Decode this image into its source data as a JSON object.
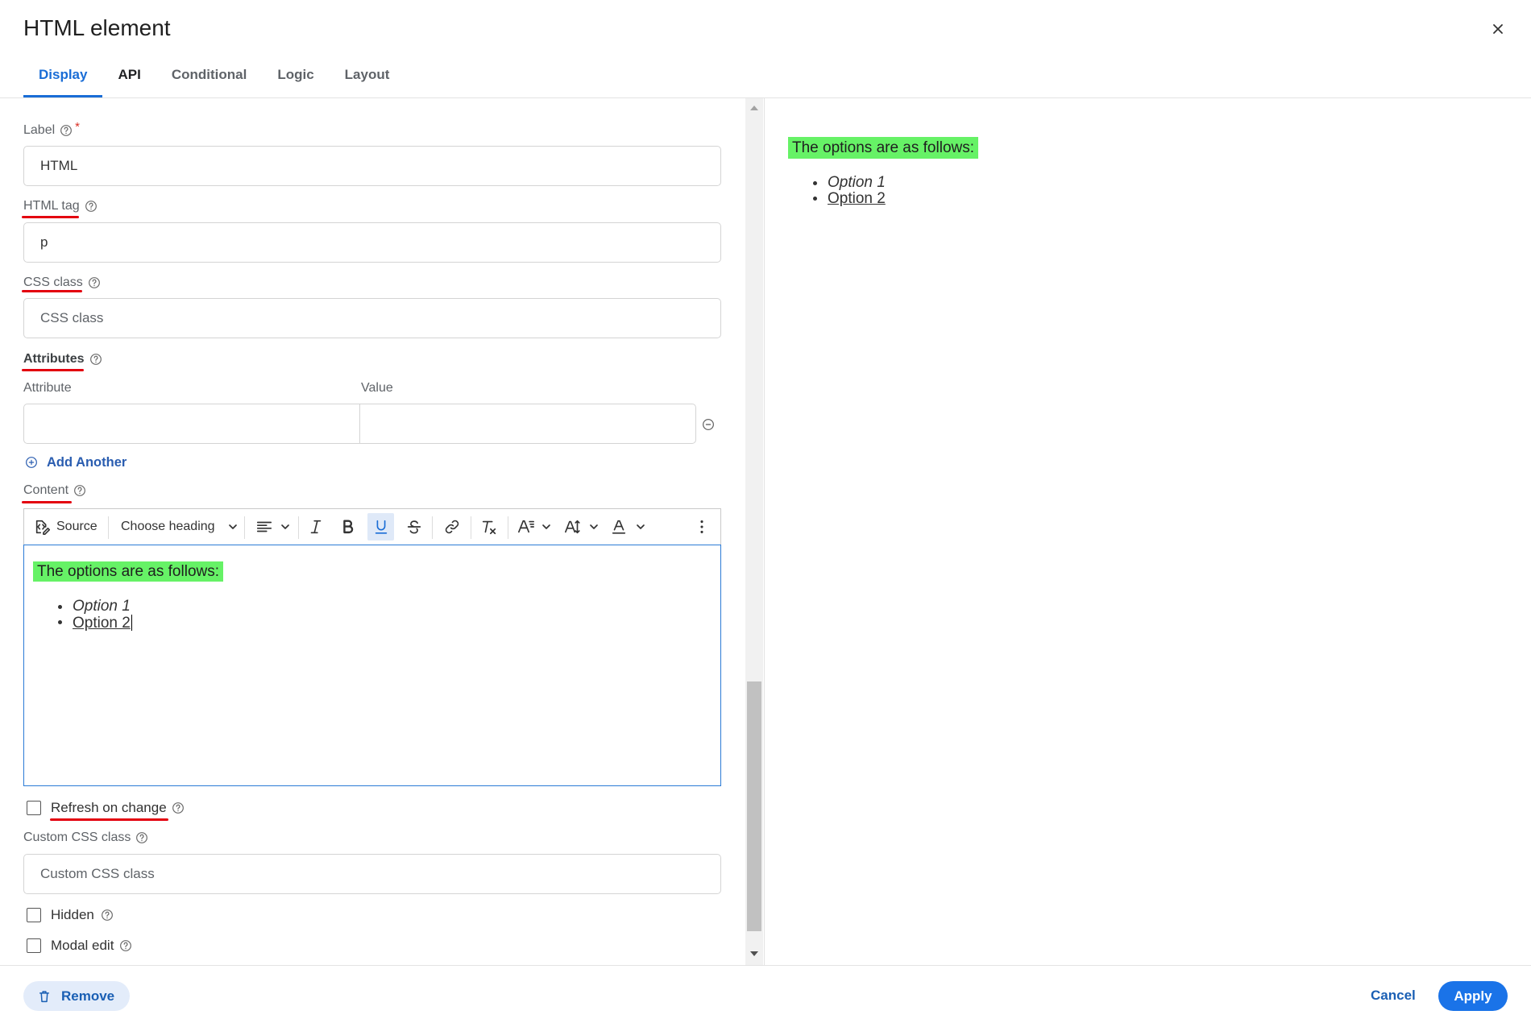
{
  "dialog": {
    "title": "HTML element",
    "close_icon": "close-icon"
  },
  "tabs": [
    {
      "label": "Display",
      "active": true
    },
    {
      "label": "API",
      "active": false
    },
    {
      "label": "Conditional",
      "active": false
    },
    {
      "label": "Logic",
      "active": false
    },
    {
      "label": "Layout",
      "active": false
    }
  ],
  "form": {
    "label_field": {
      "label": "Label",
      "required_marker": "*",
      "value": "HTML",
      "help_icon": "help-circle-icon"
    },
    "html_tag": {
      "label": "HTML tag",
      "value": "p",
      "help_icon": "help-circle-icon"
    },
    "css_class": {
      "label": "CSS class",
      "placeholder": "CSS class",
      "help_icon": "help-circle-icon"
    },
    "attributes": {
      "label": "Attributes",
      "help_icon": "help-circle-icon",
      "columns": [
        "Attribute",
        "Value"
      ],
      "rows": [
        {
          "attribute": "",
          "value": ""
        }
      ],
      "remove_row_icon": "minus-circle-icon",
      "add_label": "Add Another",
      "add_icon": "plus-circle-icon"
    },
    "content": {
      "label": "Content",
      "help_icon": "help-circle-icon",
      "toolbar": {
        "source_label": "Source",
        "heading_select": "Choose heading",
        "underline_active": true,
        "icons": [
          "source-icon",
          "align-left-icon",
          "italic-icon",
          "bold-icon",
          "underline-icon",
          "strikethrough-icon",
          "link-icon",
          "remove-format-icon",
          "font-size-icon",
          "line-height-icon",
          "font-color-icon",
          "more-vertical-icon"
        ]
      },
      "editor": {
        "highlight_text": "The options are as follows:",
        "list": [
          {
            "text": "Option 1",
            "italic": true
          },
          {
            "text": "Option 2",
            "underline": true
          }
        ]
      }
    },
    "refresh_on_change": {
      "label": "Refresh on change",
      "checked": false
    },
    "custom_css_class": {
      "label": "Custom CSS class",
      "placeholder": "Custom CSS class"
    },
    "hidden": {
      "label": "Hidden",
      "checked": false
    },
    "modal_edit": {
      "label": "Modal edit",
      "checked": false
    }
  },
  "preview": {
    "highlight_text": "The options are as follows:",
    "list": [
      {
        "text": "Option 1",
        "italic": true
      },
      {
        "text": "Option 2",
        "underline": true
      }
    ]
  },
  "footer": {
    "remove_label": "Remove",
    "remove_icon": "trash-icon",
    "cancel_label": "Cancel",
    "apply_label": "Apply"
  },
  "colors": {
    "accent": "#1a73e8",
    "active_tab": "#1a6dd6",
    "highlight": "#66f266",
    "annotation": "#e3000f",
    "link": "#2a5db0"
  }
}
